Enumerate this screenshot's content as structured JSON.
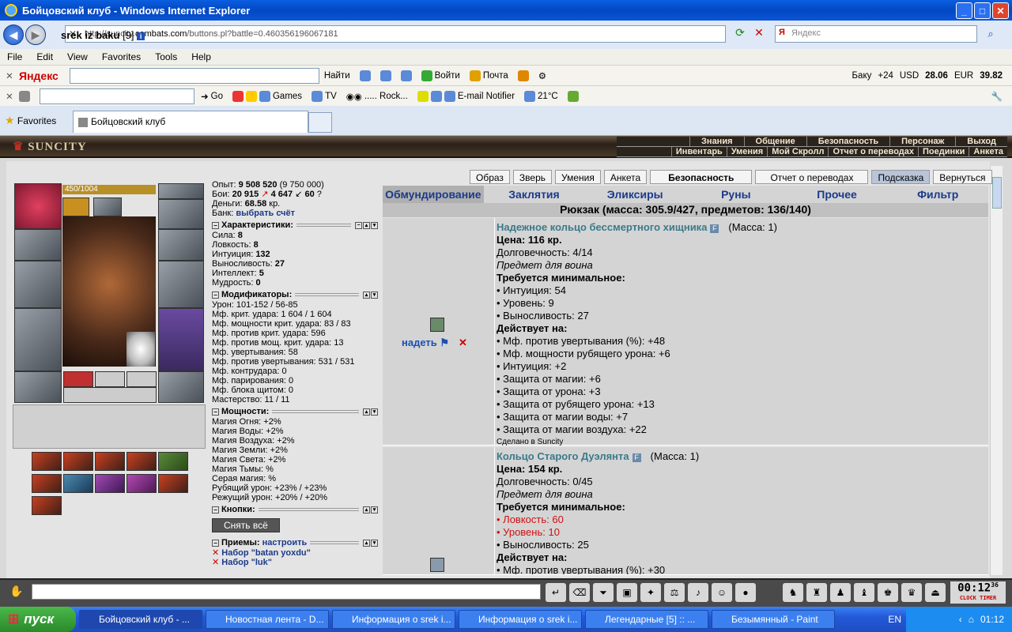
{
  "window": {
    "title": "Бойцовский клуб - Windows Internet Explorer"
  },
  "address": {
    "url_prefix": "http://suncity.",
    "url_domain": "combats.com",
    "url_path": "/buttons.pl?battle=0.460356196067181",
    "search_placeholder": "Яндекс"
  },
  "menu": [
    "File",
    "Edit",
    "View",
    "Favorites",
    "Tools",
    "Help"
  ],
  "toolbar1": {
    "brand": "Яндекс",
    "find": "Найти",
    "login": "Войти",
    "mail": "Почта",
    "city": "Баку",
    "temp": "+24",
    "usd_label": "USD",
    "usd": "28.06",
    "eur_label": "EUR",
    "eur": "39.82"
  },
  "toolbar2": {
    "go": "Go",
    "games": "Games",
    "tv": "TV",
    "radio": "..... Rock...",
    "email": "E-mail Notifier",
    "weather": "21°C"
  },
  "favorites": {
    "label": "Favorites",
    "tab": "Бойцовский клуб"
  },
  "game": {
    "logo": "SUNCITY",
    "nav_row1": [
      "Знания",
      "Общение",
      "Безопасность",
      "Персонаж",
      "Выход"
    ],
    "nav_row2": [
      "Инвентарь",
      "Умения",
      "Мой Скролл",
      "Отчет о переводах",
      "Поединки",
      "Анкета"
    ],
    "char": {
      "name": "srek iz baku",
      "level": "[9]",
      "hp": "450/1004"
    },
    "top_buttons": [
      "Образ",
      "Зверь",
      "Умения",
      "Анкета",
      "Безопасность",
      "Отчет о переводах",
      "Подсказка",
      "Вернуться"
    ],
    "info": {
      "exp_label": "Опыт:",
      "exp": "9 508 520",
      "exp_next": "(9 750 000)",
      "fights_label": "Бои:",
      "wins": "20 915",
      "losses": "4 647",
      "draws": "60",
      "money_label": "Деньги:",
      "money": "68.58",
      "money_unit": "кр.",
      "bank_label": "Банк:",
      "bank_link": "выбрать счёт"
    },
    "sections": {
      "chars": "Характеристики:",
      "mods": "Модификаторы:",
      "powers": "Мощности:",
      "buttons": "Кнопки:",
      "moves": "Приемы:",
      "moves_link": "настроить"
    },
    "characteristics": [
      {
        "label": "Сила:",
        "value": "8"
      },
      {
        "label": "Ловкость:",
        "value": "8"
      },
      {
        "label": "Интуиция:",
        "value": "132"
      },
      {
        "label": "Выносливость:",
        "value": "27"
      },
      {
        "label": "Интеллект:",
        "value": "5"
      },
      {
        "label": "Мудрость:",
        "value": "0"
      }
    ],
    "modifiers": [
      "Урон: 101-152 / 56-85",
      "Мф. крит. удара: 1 604 / 1 604",
      "Мф. мощности крит. удара: 83 / 83",
      "Мф. против крит. удара: 596",
      "Мф. против мощ. крит. удара: 13",
      "Мф. увертывания: 58",
      "Мф. против увертывания: 531 / 531",
      "Мф. контрудара: 0",
      "Мф. парирования: 0",
      "Мф. блока щитом: 0",
      "Мастерство: 11 / 11"
    ],
    "powers": [
      "Магия Огня: +2%",
      "Магия Воды: +2%",
      "Магия Воздуха: +2%",
      "Магия Земли: +2%",
      "Магия Света: +2%",
      "Магия Тьмы: %",
      "Серая магия: %",
      "Рубящий урон: +23% / +23%",
      "Режущий урон: +20% / +20%"
    ],
    "remove_all": "Снять всё",
    "moves": [
      "Набор \"batan yoxdu\"",
      "Набор \"luk\""
    ],
    "inv_tabs": [
      "Обмундирование",
      "Заклятия",
      "Эликсиры",
      "Руны",
      "Прочее",
      "Фильтр"
    ],
    "rucksack": "Рюкзак (масса: 305.9/427, предметов: 136/140)",
    "put_on": "надеть",
    "item1": {
      "name": "Надежное кольцо бессмертного хищника",
      "mass": "(Масса: 1)",
      "price": "Цена: 116 кр.",
      "durability": "Долговечность: 4/14",
      "for": "Предмет для воина",
      "req_title": "Требуется минимальное:",
      "reqs": [
        "• Интуиция: 54",
        "• Уровень: 9",
        "• Выносливость: 27"
      ],
      "acts_title": "Действует на:",
      "acts": [
        "• Мф. против увертывания (%): +48",
        "• Мф. мощности рубящего урона: +6",
        "• Интуиция: +2",
        "• Защита от магии: +6",
        "• Защита от урона: +3",
        "• Защита от рубящего урона: +13",
        "• Защита от магии воды: +7",
        "• Защита от магии воздуха: +22"
      ],
      "made": "Сделано в Suncity"
    },
    "item2": {
      "name": "Кольцо Старого Дуэлянта",
      "mass": "(Масса: 1)",
      "price": "Цена: 154 кр.",
      "durability": "Долговечность: 0/45",
      "for": "Предмет для воина",
      "req_title": "Требуется минимальное:",
      "req_red1": "• Ловкость: 60",
      "req_red2": "• Уровень: 10",
      "req3": "• Выносливость: 25",
      "acts_title": "Действует на:",
      "act1": "• Мф. против увертывания (%): +30"
    }
  },
  "clock": {
    "time": "00:12",
    "sec": "36",
    "label": "CLOCK TIMER"
  },
  "taskbar": {
    "start": "пуск",
    "tasks": [
      "Бойцовский клуб - ...",
      "Новостная лента - D...",
      "Информация о srek i...",
      "Информация о srek i...",
      "Легендарные [5] :: ...",
      "Безымянный - Paint"
    ],
    "lang": "EN",
    "time": "01:12"
  }
}
